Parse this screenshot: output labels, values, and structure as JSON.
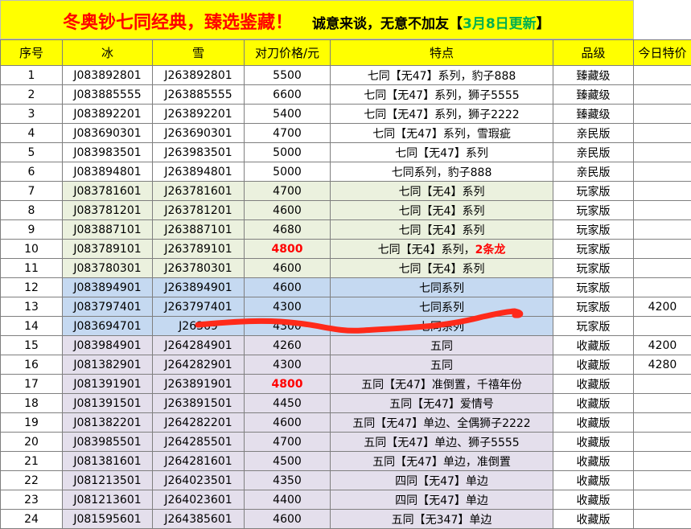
{
  "header": {
    "title_main": "冬奥钞七同经典，臻选鉴藏！",
    "title_sub_prefix": "诚意来谈，无意不加友【",
    "title_date": "3月8日更新",
    "title_sub_suffix": "】"
  },
  "columns": [
    "序号",
    "冰",
    "雪",
    "对刀价格/元",
    "特点",
    "品级",
    "今日特价"
  ],
  "rows": [
    {
      "no": "1",
      "ice": "J083892801",
      "snow": "J263892801",
      "price": "5500",
      "feature": "七同【无47】系列，豹子888",
      "feature_hl": "",
      "grade": "臻藏级",
      "special": "",
      "group": "g-zhen",
      "hl": false
    },
    {
      "no": "2",
      "ice": "J083885555",
      "snow": "J263885555",
      "price": "6600",
      "feature": "七同【无47】系列，狮子5555",
      "feature_hl": "",
      "grade": "臻藏级",
      "special": "",
      "group": "g-zhen",
      "hl": false
    },
    {
      "no": "3",
      "ice": "J083892201",
      "snow": "J263892201",
      "price": "5400",
      "feature": "七同【无47】系列，狮子2222",
      "feature_hl": "",
      "grade": "臻藏级",
      "special": "",
      "group": "g-zhen",
      "hl": false
    },
    {
      "no": "4",
      "ice": "J083690301",
      "snow": "J263690301",
      "price": "4700",
      "feature": "七同【无47】系列，雪瑕疵",
      "feature_hl": "",
      "grade": "亲民版",
      "special": "",
      "group": "g-qin",
      "hl": false
    },
    {
      "no": "5",
      "ice": "J083983501",
      "snow": "J263983501",
      "price": "5000",
      "feature": "七同【无47】系列",
      "feature_hl": "",
      "grade": "亲民版",
      "special": "",
      "group": "g-qin",
      "hl": false
    },
    {
      "no": "6",
      "ice": "J083894801",
      "snow": "J263894801",
      "price": "5000",
      "feature": "七同系列，豹子888",
      "feature_hl": "",
      "grade": "亲民版",
      "special": "",
      "group": "g-qin",
      "hl": false
    },
    {
      "no": "7",
      "ice": "J083781601",
      "snow": "J263781601",
      "price": "4700",
      "feature": "七同【无4】系列",
      "feature_hl": "",
      "grade": "玩家版",
      "special": "",
      "group": "g-wan",
      "hl": false
    },
    {
      "no": "8",
      "ice": "J083781201",
      "snow": "J263781201",
      "price": "4600",
      "feature": "七同【无4】系列",
      "feature_hl": "",
      "grade": "玩家版",
      "special": "",
      "group": "g-wan",
      "hl": false
    },
    {
      "no": "9",
      "ice": "J083887101",
      "snow": "J263887101",
      "price": "4680",
      "feature": "七同【无4】系列",
      "feature_hl": "",
      "grade": "玩家版",
      "special": "",
      "group": "g-wan",
      "hl": false
    },
    {
      "no": "10",
      "ice": "J083789101",
      "snow": "J263789101",
      "price": "4800",
      "feature": "七同【无4】系列，",
      "feature_hl": "2条龙",
      "grade": "玩家版",
      "special": "",
      "group": "g-wan",
      "hl": true
    },
    {
      "no": "11",
      "ice": "J083780301",
      "snow": "J263780301",
      "price": "4600",
      "feature": "七同【无4】系列",
      "feature_hl": "",
      "grade": "玩家版",
      "special": "",
      "group": "g-wan",
      "hl": false
    },
    {
      "no": "12",
      "ice": "J083894901",
      "snow": "J263894901",
      "price": "4600",
      "feature": "七同系列",
      "feature_hl": "",
      "grade": "玩家版",
      "special": "",
      "group": "g-blue",
      "hl": false
    },
    {
      "no": "13",
      "ice": "J083797401",
      "snow": "J263797401",
      "price": "4300",
      "feature": "七同系列",
      "feature_hl": "",
      "grade": "玩家版",
      "special": "4200",
      "group": "g-blue",
      "hl": false
    },
    {
      "no": "14",
      "ice": "J083694701",
      "snow": "J26369",
      "price": "4300",
      "feature": "七同系列",
      "feature_hl": "",
      "grade": "玩家版",
      "special": "",
      "group": "g-blue",
      "hl": false
    },
    {
      "no": "15",
      "ice": "J083984901",
      "snow": "J264284901",
      "price": "4260",
      "feature": "五同",
      "feature_hl": "",
      "grade": "收藏版",
      "special": "4200",
      "group": "g-shou",
      "hl": false
    },
    {
      "no": "16",
      "ice": "J081382901",
      "snow": "J264282901",
      "price": "4300",
      "feature": "五同",
      "feature_hl": "",
      "grade": "收藏版",
      "special": "4280",
      "group": "g-shou",
      "hl": false
    },
    {
      "no": "17",
      "ice": "J081391901",
      "snow": "J263891901",
      "price": "4800",
      "feature": "五同【无47】准倒置，千禧年份",
      "feature_hl": "",
      "grade": "收藏版",
      "special": "",
      "group": "g-shou",
      "hl": true
    },
    {
      "no": "18",
      "ice": "J081391501",
      "snow": "J263891501",
      "price": "4450",
      "feature": "五同【无47】爱情号",
      "feature_hl": "",
      "grade": "收藏版",
      "special": "",
      "group": "g-shou",
      "hl": false
    },
    {
      "no": "19",
      "ice": "J081382201",
      "snow": "J264282201",
      "price": "4600",
      "feature": "五同【无47】单边、全偶狮子2222",
      "feature_hl": "",
      "grade": "收藏版",
      "special": "",
      "group": "g-shou",
      "hl": false
    },
    {
      "no": "20",
      "ice": "J083985501",
      "snow": "J264285501",
      "price": "4700",
      "feature": "五同【无47】单边、狮子5555",
      "feature_hl": "",
      "grade": "收藏版",
      "special": "",
      "group": "g-shou",
      "hl": false
    },
    {
      "no": "21",
      "ice": "J081381601",
      "snow": "J264281601",
      "price": "4500",
      "feature": "五同【无47】单边，准倒置",
      "feature_hl": "",
      "grade": "收藏版",
      "special": "",
      "group": "g-shou",
      "hl": false
    },
    {
      "no": "22",
      "ice": "J081213501",
      "snow": "J264023501",
      "price": "4350",
      "feature": "四同【无47】单边",
      "feature_hl": "",
      "grade": "收藏版",
      "special": "",
      "group": "g-shou",
      "hl": false
    },
    {
      "no": "23",
      "ice": "J081213601",
      "snow": "J264023601",
      "price": "4400",
      "feature": "四同【无47】单边",
      "feature_hl": "",
      "grade": "收藏版",
      "special": "",
      "group": "g-shou",
      "hl": false
    },
    {
      "no": "24",
      "ice": "J081595601",
      "snow": "J264385601",
      "price": "4600",
      "feature": "五同【无347】单边",
      "feature_hl": "",
      "grade": "收藏版",
      "special": "",
      "group": "g-shou",
      "hl": false
    }
  ],
  "colors": {
    "title_bg": "#ffff00",
    "title_main": "#ff0000",
    "title_date": "#00b050",
    "highlight": "#ff0000",
    "shade_green": "#ebf1de",
    "shade_blue": "#c5d9f1",
    "shade_purple": "#e4dfec",
    "scribble": "#ff2a1a"
  }
}
